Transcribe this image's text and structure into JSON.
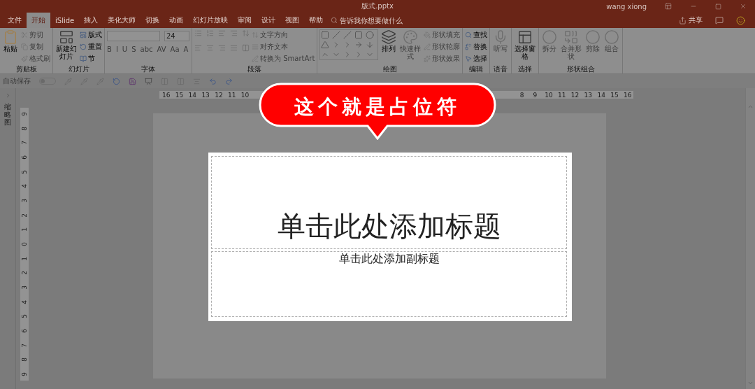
{
  "window": {
    "title": "版式.pptx",
    "user": "wang xiong"
  },
  "tabs": [
    {
      "label": "文件",
      "selected": false
    },
    {
      "label": "开始",
      "selected": true
    },
    {
      "label": "iSlide",
      "selected": false
    },
    {
      "label": "插入",
      "selected": false
    },
    {
      "label": "美化大师",
      "selected": false
    },
    {
      "label": "切换",
      "selected": false
    },
    {
      "label": "动画",
      "selected": false
    },
    {
      "label": "幻灯片放映",
      "selected": false
    },
    {
      "label": "审阅",
      "selected": false
    },
    {
      "label": "设计",
      "selected": false
    },
    {
      "label": "视图",
      "selected": false
    },
    {
      "label": "帮助",
      "selected": false
    }
  ],
  "tell_me": {
    "placeholder": "告诉我你想要做什么"
  },
  "share": {
    "label": "共享"
  },
  "ribbon": {
    "groups": [
      {
        "label": "剪贴板",
        "items": [
          {
            "kind": "big",
            "label": "粘贴",
            "disabled": false
          },
          {
            "kind": "small",
            "label": "剪切",
            "disabled": true
          },
          {
            "kind": "small",
            "label": "复制",
            "disabled": true
          },
          {
            "kind": "small",
            "label": "格式刷",
            "disabled": true
          }
        ]
      },
      {
        "label": "幻灯片",
        "items": [
          {
            "kind": "big",
            "label": "新建幻灯片",
            "disabled": false
          },
          {
            "kind": "small",
            "label": "版式",
            "disabled": false
          },
          {
            "kind": "small",
            "label": "重置",
            "disabled": false
          },
          {
            "kind": "small",
            "label": "节",
            "disabled": false
          }
        ]
      },
      {
        "label": "字体",
        "items": [
          {
            "kind": "field",
            "disabled": true
          },
          {
            "kind": "field",
            "value": "24",
            "disabled": true
          },
          {
            "kind": "glyph",
            "label": "B",
            "disabled": true
          },
          {
            "kind": "glyph",
            "label": "I",
            "disabled": true
          },
          {
            "kind": "glyph",
            "label": "U",
            "disabled": true
          },
          {
            "kind": "glyph",
            "label": "S",
            "disabled": true
          },
          {
            "kind": "glyph",
            "label": "abc",
            "disabled": true
          },
          {
            "kind": "glyph",
            "label": "AV",
            "disabled": true
          },
          {
            "kind": "glyph",
            "label": "Aa",
            "disabled": true
          },
          {
            "kind": "glyph",
            "label": "A",
            "disabled": true
          }
        ]
      },
      {
        "label": "段落",
        "items": [
          {
            "kind": "small",
            "label": "文字方向",
            "disabled": true
          },
          {
            "kind": "small",
            "label": "对齐文本",
            "disabled": true
          },
          {
            "kind": "small",
            "label": "转换为 SmartArt",
            "disabled": true
          }
        ]
      },
      {
        "label": "绘图",
        "items": [
          {
            "kind": "gallery",
            "disabled": false
          },
          {
            "kind": "big",
            "label": "排列",
            "disabled": false
          },
          {
            "kind": "big",
            "label": "快速样式",
            "disabled": true
          },
          {
            "kind": "small",
            "label": "形状填充",
            "disabled": true
          },
          {
            "kind": "small",
            "label": "形状轮廓",
            "disabled": true
          },
          {
            "kind": "small",
            "label": "形状效果",
            "disabled": true
          }
        ]
      },
      {
        "label": "编辑",
        "items": [
          {
            "kind": "small",
            "label": "查找",
            "disabled": false
          },
          {
            "kind": "small",
            "label": "替换",
            "disabled": false
          },
          {
            "kind": "small",
            "label": "选择",
            "disabled": false
          }
        ]
      },
      {
        "label": "语音",
        "items": [
          {
            "kind": "big",
            "label": "听写",
            "disabled": true
          }
        ]
      },
      {
        "label": "选择",
        "items": [
          {
            "kind": "big",
            "label": "选择窗格",
            "disabled": false
          }
        ]
      },
      {
        "label": "形状组合",
        "items": [
          {
            "kind": "big",
            "label": "拆分",
            "disabled": true
          },
          {
            "kind": "big",
            "label": "合并形状",
            "disabled": true
          },
          {
            "kind": "big",
            "label": "剪除",
            "disabled": true
          },
          {
            "kind": "big",
            "label": "组合",
            "disabled": true
          }
        ]
      }
    ]
  },
  "quick_access": {
    "autosave_label": "自动保存",
    "autosave_on": false
  },
  "thumbnail_pane": {
    "label": "缩略图"
  },
  "ruler": {
    "left_numbers": [
      "16",
      "15",
      "14",
      "13",
      "12",
      "11",
      "10"
    ],
    "right_numbers": [
      "8",
      "9",
      "10",
      "11",
      "12",
      "13",
      "14",
      "15",
      "16"
    ],
    "vertical_numbers": [
      "9",
      "8",
      "7",
      "6",
      "5",
      "4",
      "3",
      "2",
      "1",
      "0",
      "1",
      "2",
      "3",
      "4",
      "5",
      "6",
      "7",
      "8",
      "9"
    ]
  },
  "slide": {
    "title_placeholder": "单击此处添加标题",
    "subtitle_placeholder": "单击此处添加副标题"
  },
  "callout": {
    "text": "这个就是占位符"
  }
}
